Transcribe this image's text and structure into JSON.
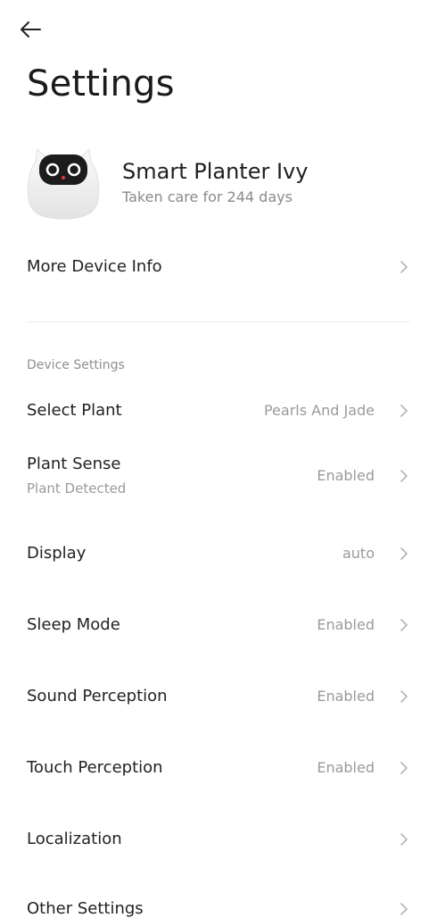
{
  "header": {
    "back_icon": "arrow-left-icon",
    "title": "Settings"
  },
  "device": {
    "name": "Smart Planter Ivy",
    "subtitle": "Taken care for 244 days"
  },
  "more_info": {
    "label": "More Device Info"
  },
  "section": {
    "title": "Device Settings"
  },
  "settings": [
    {
      "label": "Select Plant",
      "value": "Pearls And Jade"
    },
    {
      "label": "Plant Sense",
      "sublabel": "Plant Detected",
      "value": "Enabled"
    },
    {
      "label": "Display",
      "value": "auto"
    },
    {
      "label": "Sleep Mode",
      "value": "Enabled"
    },
    {
      "label": "Sound Perception",
      "value": "Enabled"
    },
    {
      "label": "Touch Perception",
      "value": "Enabled"
    },
    {
      "label": "Localization",
      "value": ""
    },
    {
      "label": "Other Settings",
      "value": ""
    }
  ]
}
